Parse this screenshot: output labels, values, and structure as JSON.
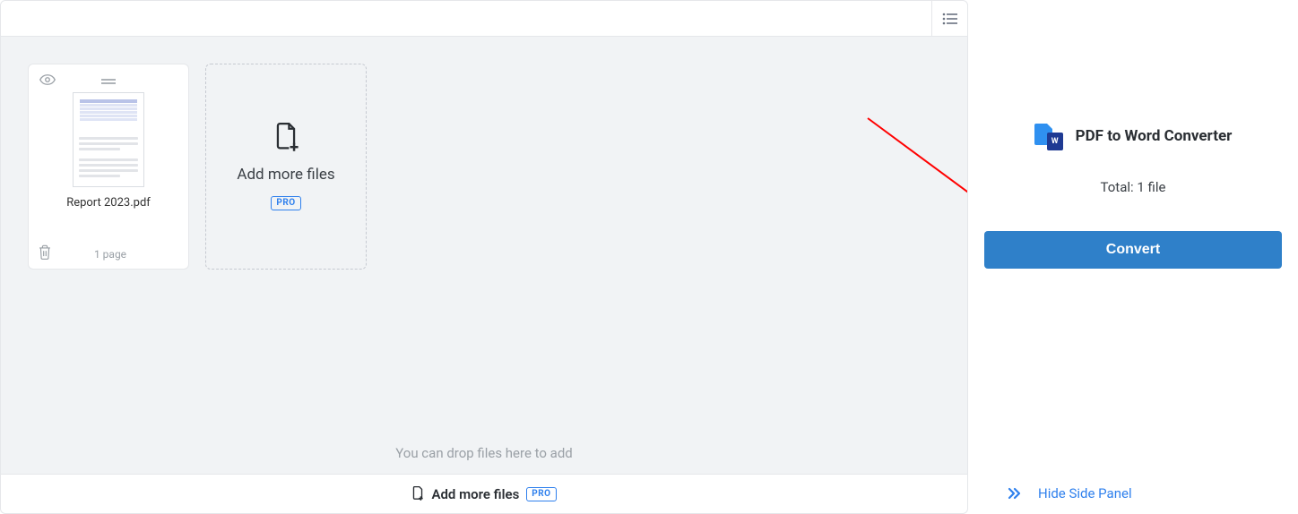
{
  "file": {
    "name": "Report 2023.pdf",
    "pages_label": "1 page"
  },
  "add_card": {
    "label": "Add more files",
    "badge": "PRO"
  },
  "drop_hint": "You can drop files here to add",
  "bottombar": {
    "label": "Add more files",
    "badge": "PRO"
  },
  "side": {
    "title": "PDF to Word Converter",
    "word_icon_letter": "W",
    "total": "Total: 1 file",
    "convert": "Convert",
    "hide": "Hide Side Panel"
  }
}
